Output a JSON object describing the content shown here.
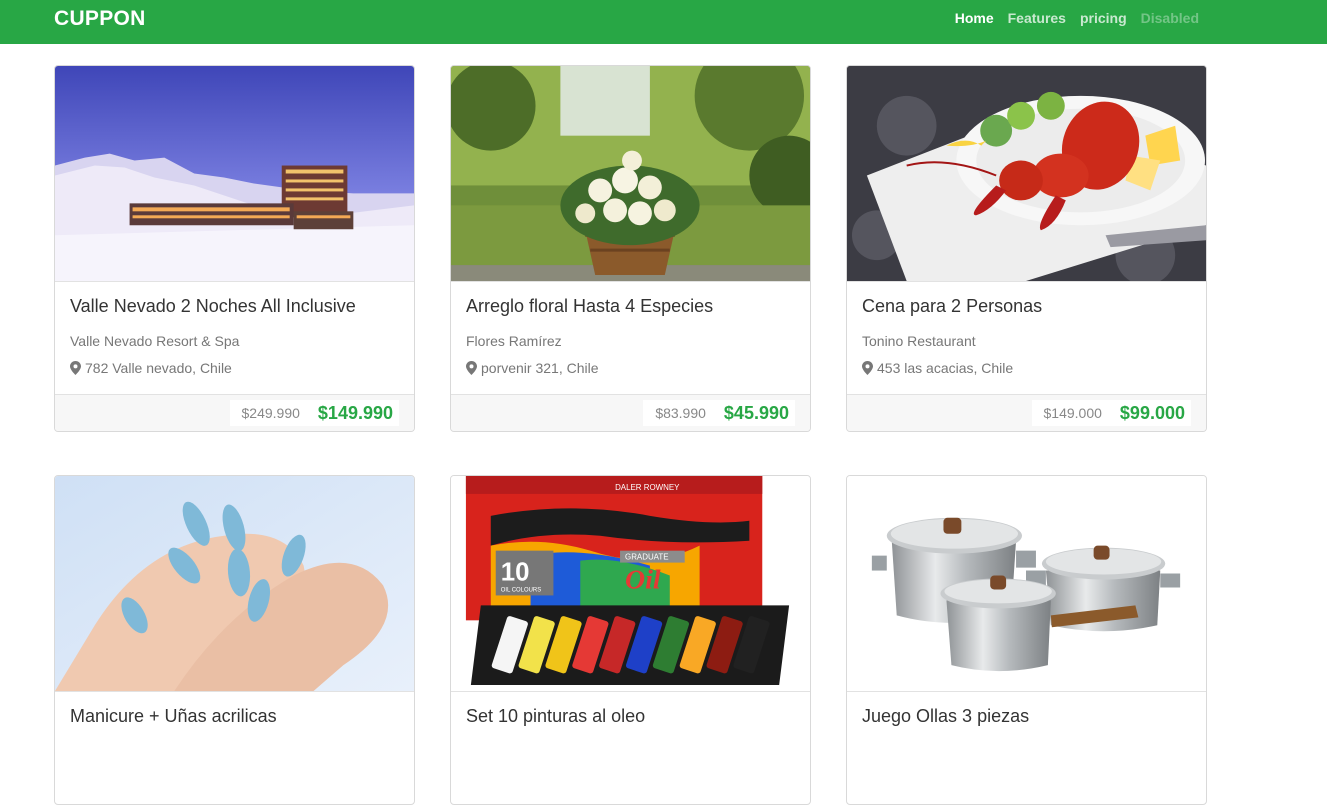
{
  "navbar": {
    "brand": "CUPPON",
    "links": [
      {
        "label": "Home",
        "state": "active"
      },
      {
        "label": "Features",
        "state": "normal"
      },
      {
        "label": "pricing",
        "state": "normal"
      },
      {
        "label": "Disabled",
        "state": "disabled"
      }
    ]
  },
  "cards": [
    {
      "title": "Valle Nevado 2 Noches All Inclusive",
      "vendor": "Valle Nevado Resort & Spa",
      "address": "782 Valle nevado, Chile",
      "old_price": "$249.990",
      "new_price": "$149.990",
      "image": "ski-resort"
    },
    {
      "title": "Arreglo floral Hasta 4 Especies",
      "vendor": "Flores Ramírez",
      "address": "porvenir 321, Chile",
      "old_price": "$83.990",
      "new_price": "$45.990",
      "image": "flower-basket"
    },
    {
      "title": "Cena para 2 Personas",
      "vendor": "Tonino Restaurant",
      "address": "453 las acacias, Chile",
      "old_price": "$149.000",
      "new_price": "$99.000",
      "image": "lobster-dinner"
    },
    {
      "title": "Manicure + Uñas acrilicas",
      "image": "manicure-nails"
    },
    {
      "title": "Set 10 pinturas al oleo",
      "image": "oil-paint-set"
    },
    {
      "title": "Juego Ollas 3 piezas",
      "image": "cooking-pots"
    }
  ],
  "image_text": {
    "paint_brand": "DALER ROWNEY",
    "paint_count": "10",
    "paint_count_label": "OIL COLOURS",
    "paint_series": "GRADUATE",
    "paint_oil": "Oil"
  },
  "colors": {
    "primary": "#28a745"
  }
}
